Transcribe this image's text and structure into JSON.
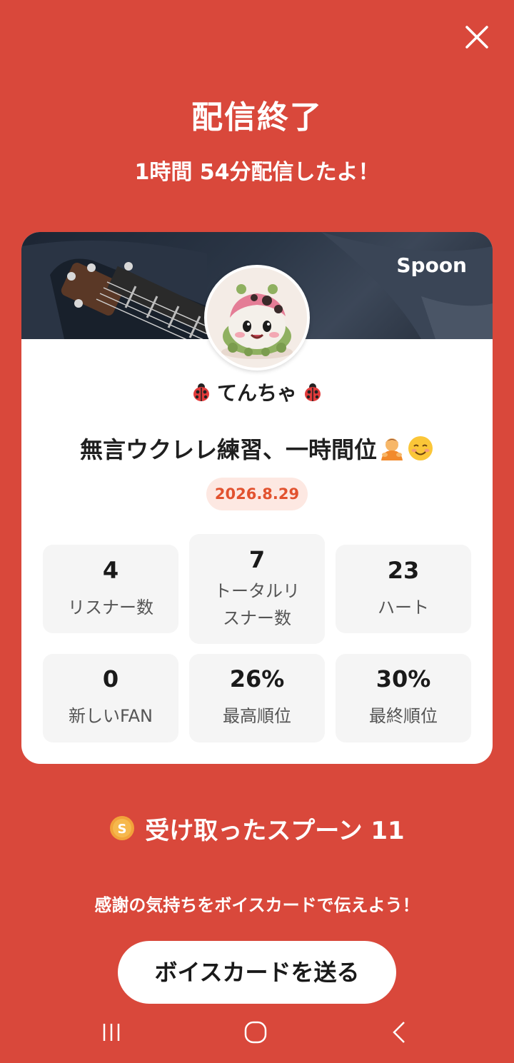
{
  "header": {
    "title": "配信終了",
    "subtitle": "1時間 54分配信したよ！"
  },
  "card": {
    "brand": "Spoon",
    "username": "てんちゃ",
    "stream_title": "無言ウクレレ練習、一時間位",
    "date": "2026.8.29",
    "stats": [
      {
        "value": "4",
        "label": "リスナー数"
      },
      {
        "value": "7",
        "label": "トータルリスナー数"
      },
      {
        "value": "23",
        "label": "ハート"
      },
      {
        "value": "0",
        "label": "新しいFAN"
      },
      {
        "value": "26%",
        "label": "最高順位"
      },
      {
        "value": "30%",
        "label": "最終順位"
      }
    ]
  },
  "spoons": {
    "label": "受け取ったスプーン 11"
  },
  "footer": {
    "thanks": "感謝の気持ちをボイスカードで伝えよう！",
    "send_button": "ボイスカードを送る"
  },
  "icons": {
    "close": "close-icon",
    "coin": "spoon-coin-icon",
    "nav_recent": "recent-apps-icon",
    "nav_home": "home-icon",
    "nav_back": "back-icon"
  },
  "colors": {
    "background": "#D9483B",
    "date_badge_bg": "#FDE8E2",
    "date_badge_text": "#E2522F",
    "stat_bg": "#F5F5F5"
  }
}
